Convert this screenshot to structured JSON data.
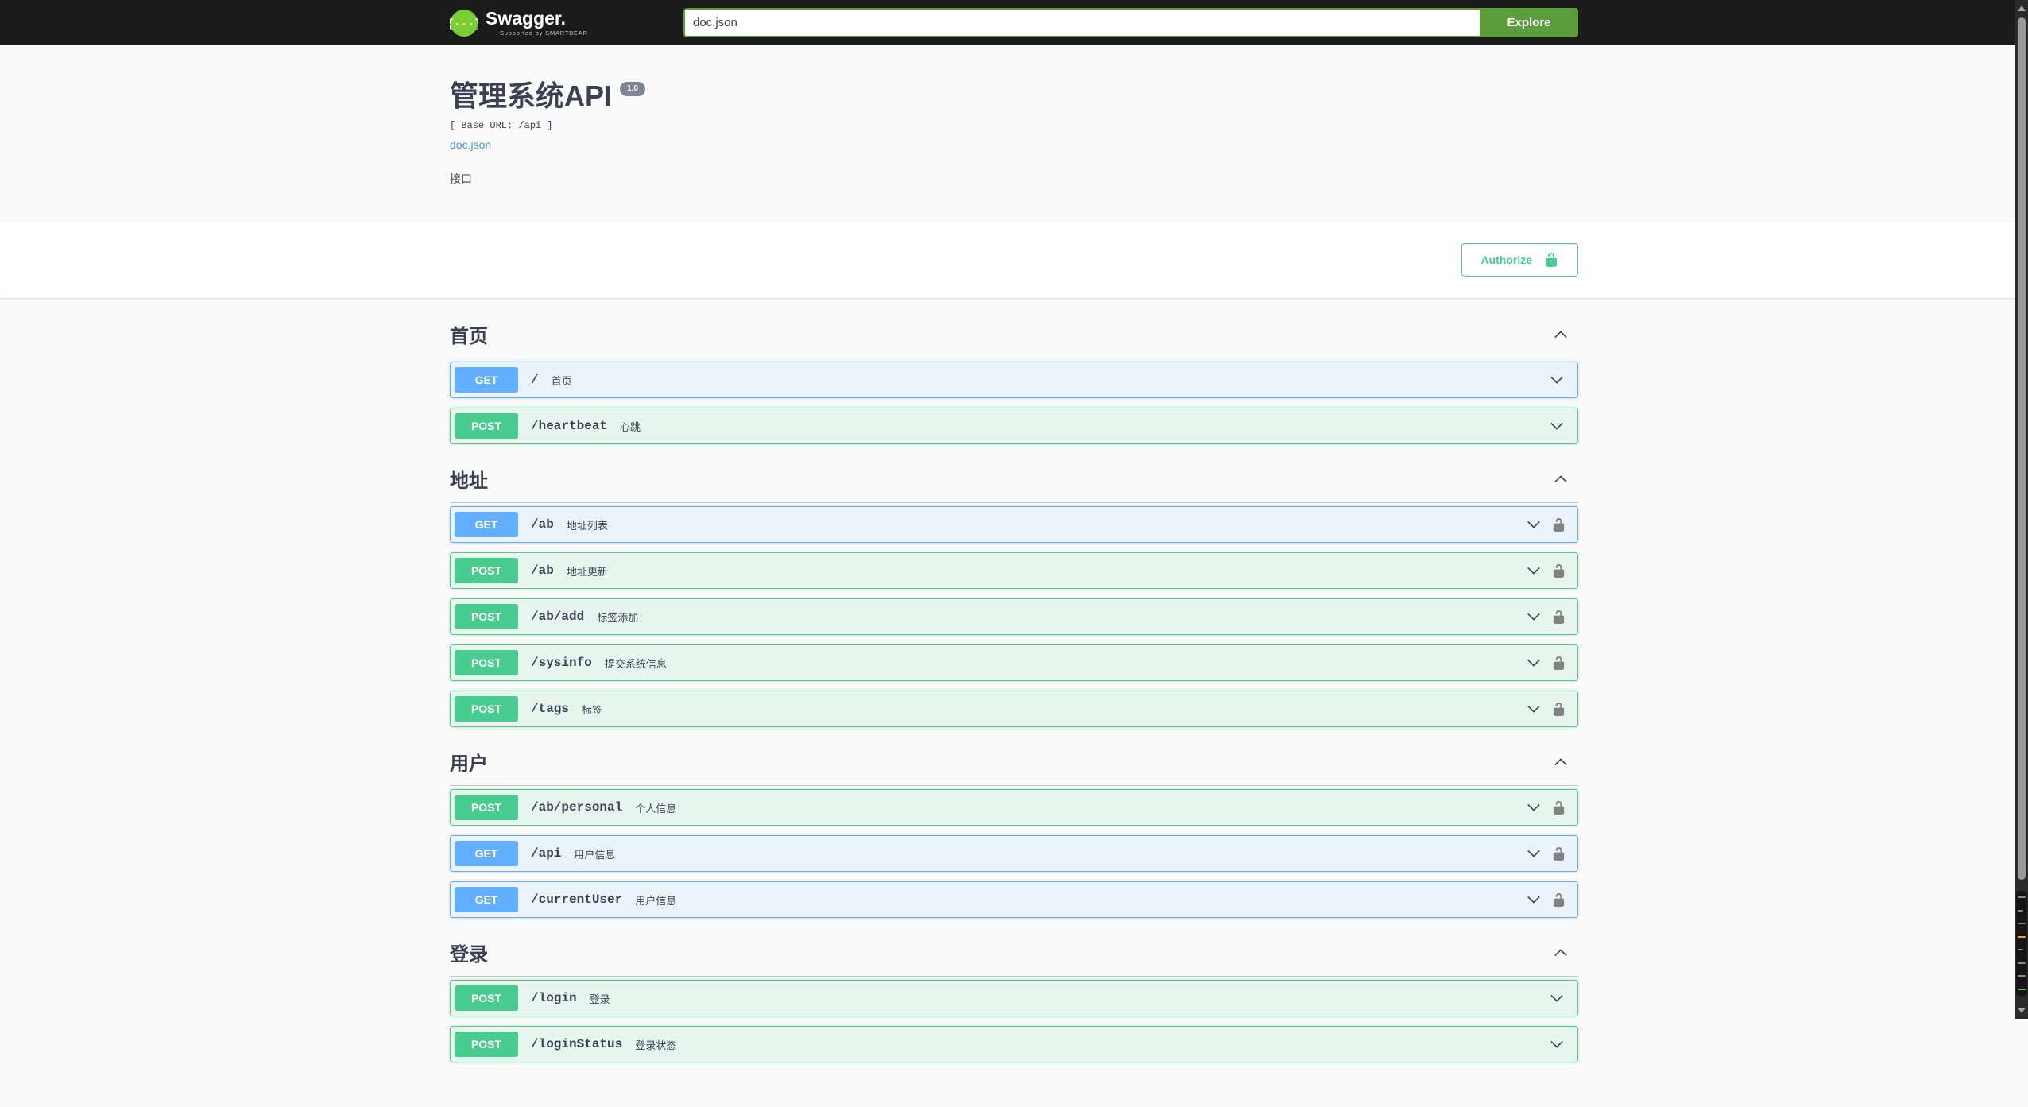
{
  "topbar": {
    "brand": "Swagger.",
    "tagline": "Supported by SMARTBEAR",
    "search_value": "doc.json",
    "explore_label": "Explore"
  },
  "info": {
    "title": "管理系统API",
    "version_badge": "1.0",
    "base_url_line": "[ Base URL: /api ]",
    "spec_link": "doc.json",
    "description": "接口"
  },
  "auth": {
    "authorize_label": "Authorize"
  },
  "sections": [
    {
      "title": "首页",
      "operations": [
        {
          "method": "GET",
          "path": "/",
          "summary": "首页",
          "lock": false
        },
        {
          "method": "POST",
          "path": "/heartbeat",
          "summary": "心跳",
          "lock": false
        }
      ]
    },
    {
      "title": "地址",
      "operations": [
        {
          "method": "GET",
          "path": "/ab",
          "summary": "地址列表",
          "lock": true
        },
        {
          "method": "POST",
          "path": "/ab",
          "summary": "地址更新",
          "lock": true
        },
        {
          "method": "POST",
          "path": "/ab/add",
          "summary": "标签添加",
          "lock": true
        },
        {
          "method": "POST",
          "path": "/sysinfo",
          "summary": "提交系统信息",
          "lock": true
        },
        {
          "method": "POST",
          "path": "/tags",
          "summary": "标签",
          "lock": true
        }
      ]
    },
    {
      "title": "用户",
      "operations": [
        {
          "method": "POST",
          "path": "/ab/personal",
          "summary": "个人信息",
          "lock": true
        },
        {
          "method": "GET",
          "path": "/api",
          "summary": "用户信息",
          "lock": true
        },
        {
          "method": "GET",
          "path": "/currentUser",
          "summary": "用户信息",
          "lock": true
        }
      ]
    },
    {
      "title": "登录",
      "operations": [
        {
          "method": "POST",
          "path": "/login",
          "summary": "登录",
          "lock": false
        },
        {
          "method": "POST",
          "path": "/loginStatus",
          "summary": "登录状态",
          "lock": false
        }
      ]
    }
  ],
  "colors": {
    "topbar_bg": "#1b1b1b",
    "logo_green": "#7ace32",
    "explore_green": "#5c9e3c",
    "get_blue": "#61affe",
    "post_green": "#49cc90",
    "link_blue": "#4990e2",
    "text_dark": "#3b4151",
    "version_badge_bg": "#7d8492"
  }
}
